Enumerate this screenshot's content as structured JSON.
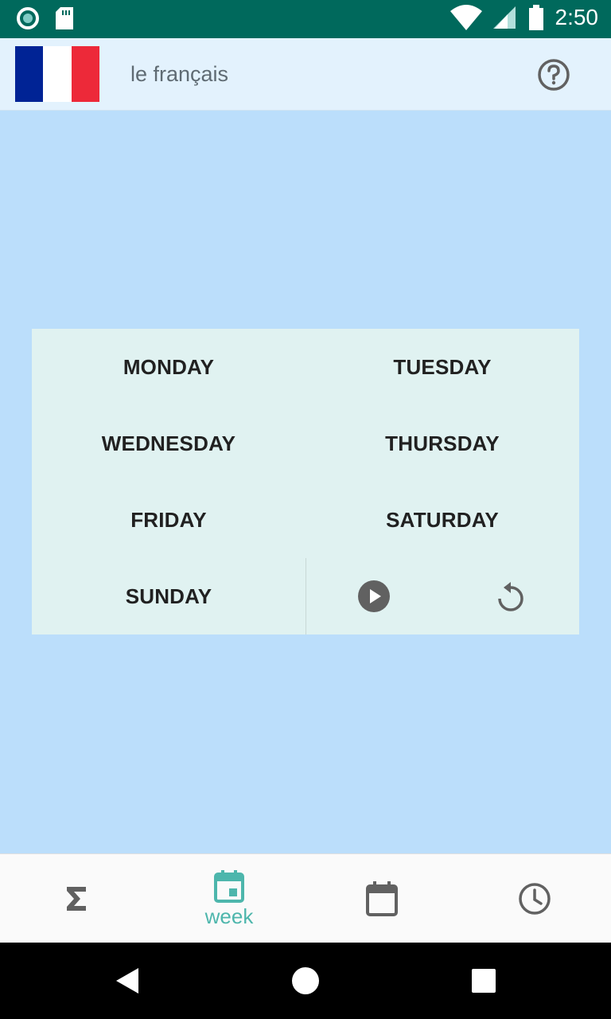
{
  "status_bar": {
    "time": "2:50",
    "icons": [
      "circle-notification-icon",
      "sd-card-icon",
      "wifi-icon",
      "cell-signal-icon",
      "battery-icon"
    ]
  },
  "header": {
    "language": "le français",
    "flag_colors": [
      "#002395",
      "#ffffff",
      "#ed2939"
    ],
    "help_icon": "help-circle-icon"
  },
  "days": {
    "monday": "MONDAY",
    "tuesday": "TUESDAY",
    "wednesday": "WEDNESDAY",
    "thursday": "THURSDAY",
    "friday": "FRIDAY",
    "saturday": "SATURDAY",
    "sunday": "SUNDAY"
  },
  "controls": {
    "play_icon": "play-circle-icon",
    "reset_icon": "replay-icon"
  },
  "bottom_nav": {
    "items": [
      {
        "icon": "sigma-icon",
        "label": ""
      },
      {
        "icon": "calendar-week-icon",
        "label": "week"
      },
      {
        "icon": "calendar-icon",
        "label": ""
      },
      {
        "icon": "clock-icon",
        "label": ""
      }
    ],
    "active_color": "#4db6ac",
    "inactive_color": "#616161"
  },
  "colors": {
    "status_bar": "#00695c",
    "header_bg": "#e3f2fd",
    "page_bg": "#bbdefb",
    "card_bg": "#e0f2f1"
  }
}
